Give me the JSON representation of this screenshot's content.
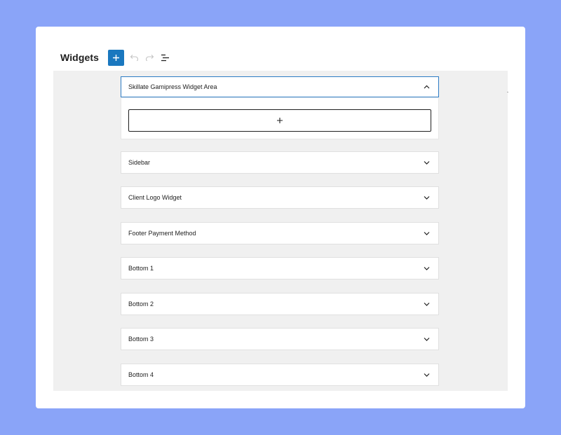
{
  "header": {
    "title": "Widgets",
    "icons": {
      "add": "plus-icon",
      "undo": "undo-icon",
      "redo": "redo-icon",
      "list_view": "list-view-icon"
    }
  },
  "colors": {
    "background": "#8aa4f8",
    "accent": "#1a78bf",
    "canvas": "#f0f0f0",
    "focus_border": "#2c7bc4"
  },
  "widget_areas": [
    {
      "label": "Skillate Gamipress Widget Area",
      "expanded": true
    },
    {
      "label": "Sidebar",
      "expanded": false
    },
    {
      "label": "Client Logo Widget",
      "expanded": false
    },
    {
      "label": "Footer Payment Method",
      "expanded": false
    },
    {
      "label": "Bottom 1",
      "expanded": false
    },
    {
      "label": "Bottom 2",
      "expanded": false
    },
    {
      "label": "Bottom 3",
      "expanded": false
    },
    {
      "label": "Bottom 4",
      "expanded": false
    }
  ]
}
